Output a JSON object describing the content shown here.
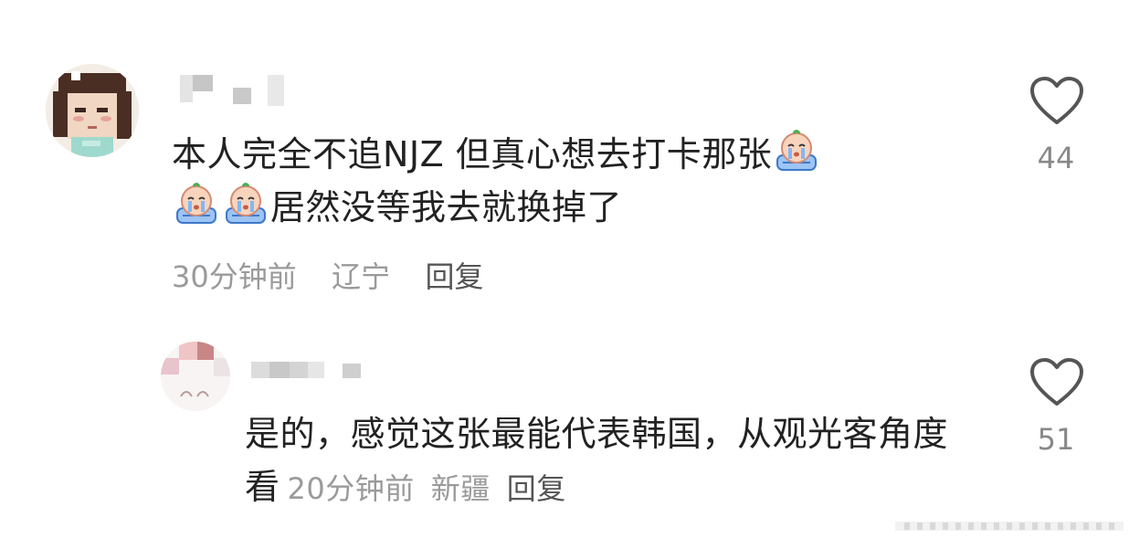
{
  "comments": [
    {
      "text_line1": "本人完全不追NJZ 但真心想去打卡那张",
      "text_line2": "居然没等我去就换掉了",
      "time": "30分钟前",
      "location": "辽宁",
      "reply_label": "回复",
      "like_count": "44",
      "emoji_icon": "crying-emoji-icon"
    },
    {
      "text": "是的，感觉这张最能代表韩国，从观光客角度看",
      "time": "20分钟前",
      "location": "新疆",
      "reply_label": "回复",
      "like_count": "51"
    }
  ],
  "colors": {
    "text": "#222222",
    "meta": "#9a9a9a",
    "count": "#888888",
    "heart_stroke": "#555555"
  }
}
